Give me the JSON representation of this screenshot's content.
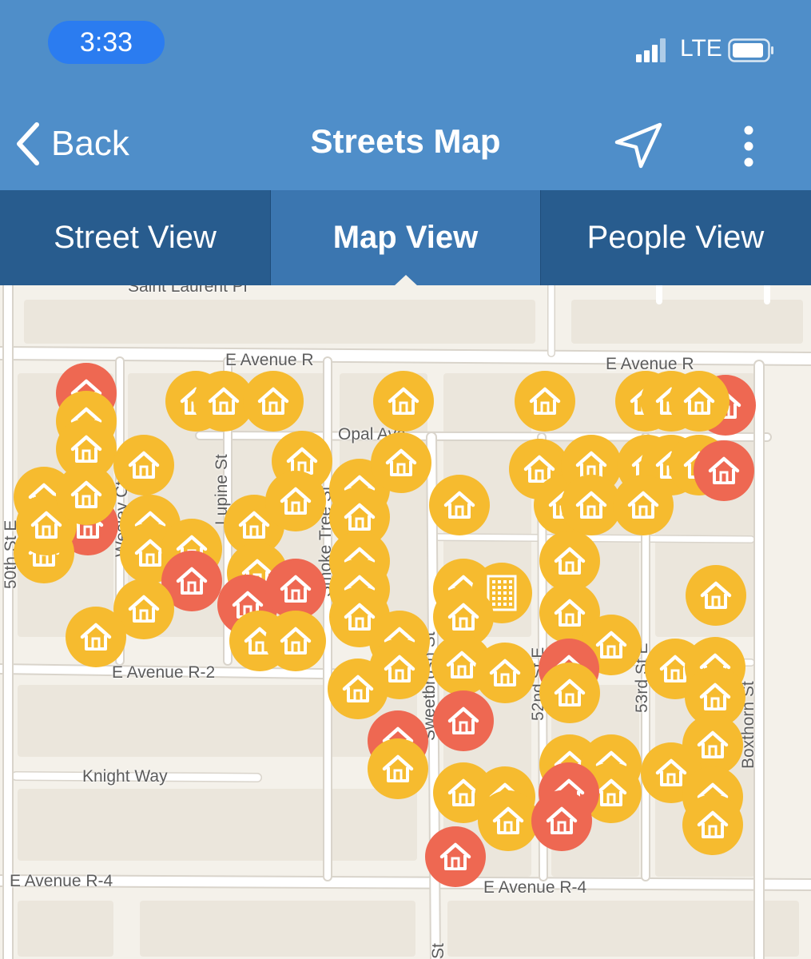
{
  "status_bar": {
    "time": "3:33",
    "network": "LTE",
    "icons": [
      "signal-bars-icon",
      "battery-icon"
    ]
  },
  "nav": {
    "back_label": "Back",
    "title": "Streets Map",
    "icons": [
      "chevron-left-icon",
      "location-arrow-icon",
      "more-vertical-icon"
    ]
  },
  "tabs": [
    {
      "label": "Street View",
      "active": false
    },
    {
      "label": "Map View",
      "active": true
    },
    {
      "label": "People View",
      "active": false
    }
  ],
  "map": {
    "street_labels": {
      "saint_laurent": "Saint Laurent Pl",
      "avenue_r_west": "E Avenue R",
      "avenue_r_east": "E Avenue R",
      "opal": "Opal Ave",
      "avenue_r2": "E Avenue R-2",
      "knight_way": "Knight Way",
      "avenue_r4_west": "E Avenue R-4",
      "avenue_r4_east": "E Avenue R-4",
      "fiftieth": "50th St E",
      "wesley": "Wesley Ct",
      "lupine": "Lupine St",
      "smoke_tree": "Smoke Tree St",
      "sweetbrush": "Sweetbrush St",
      "fifty_second": "52nd St E",
      "fifty_third": "53rd St E",
      "boxthorn": "Boxthorn St",
      "bottom_st": "St"
    },
    "marker_colors": {
      "yellow": "#f6bb2f",
      "red": "#ee6852"
    },
    "marker_icons": [
      "house-icon",
      "building-icon"
    ]
  }
}
